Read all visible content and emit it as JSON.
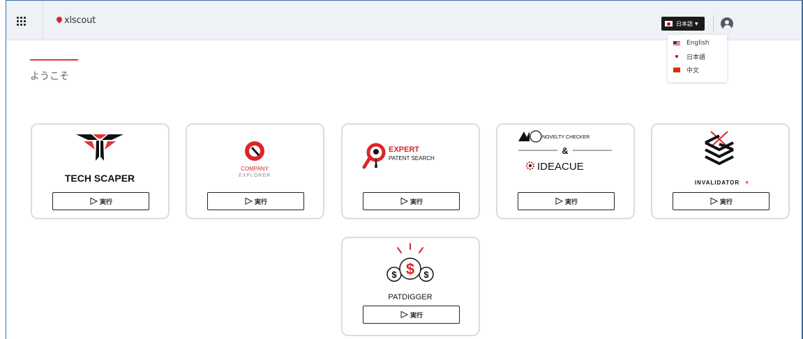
{
  "header": {
    "brand": "xlscout",
    "language_button": {
      "label": "日本語",
      "flag": "jp"
    },
    "language_menu": [
      {
        "label": "English",
        "flag": "us"
      },
      {
        "label": "日本語",
        "flag": "jp"
      },
      {
        "label": "中文",
        "flag": "cn"
      }
    ]
  },
  "main": {
    "welcome": "ようこそ",
    "accent_color": "#e63232",
    "tools": [
      {
        "name": "TECH SCAPER",
        "button": "実行"
      },
      {
        "name": "COMPANY",
        "name2": "EXPLORER",
        "button": "実行"
      },
      {
        "name": "EXPERT",
        "name2": "PATENT SEARCH",
        "button": "実行"
      },
      {
        "name": "NOVELTY CHECKER",
        "amp": "&",
        "name2": "IDEACUE",
        "button": "実行"
      },
      {
        "name": "INVALIDATOR",
        "plus": "+",
        "button": "実行"
      },
      {
        "name": "PATDIGGER",
        "button": "実行"
      }
    ]
  }
}
